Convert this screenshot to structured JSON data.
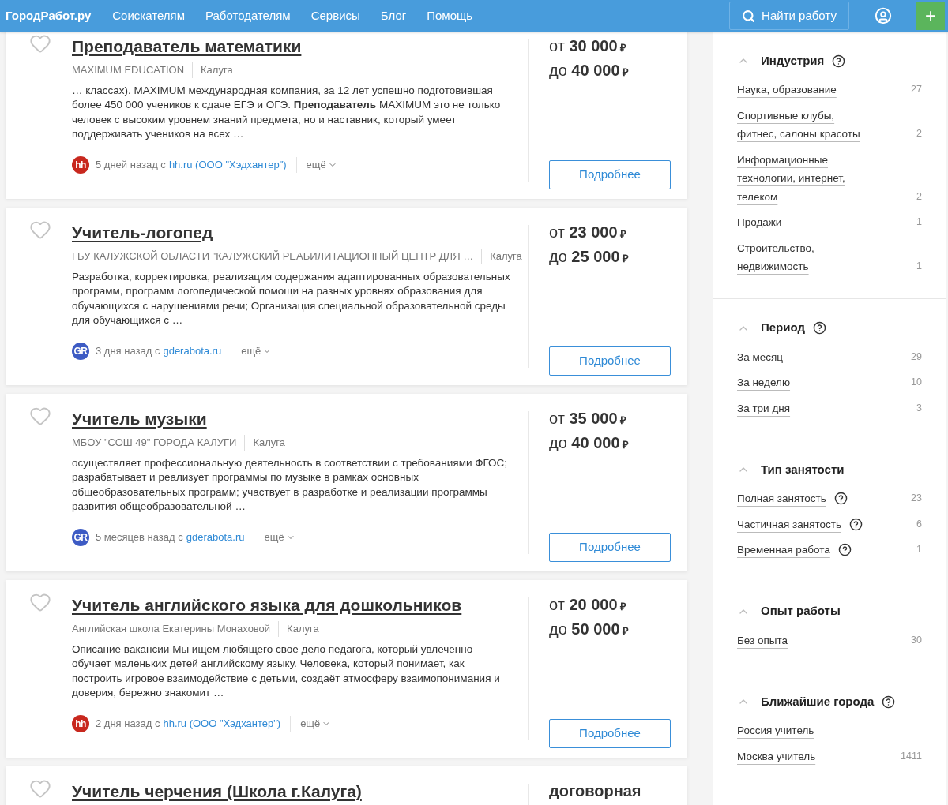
{
  "header": {
    "logo": "ГородРабот.ру",
    "nav": [
      "Соискателям",
      "Работодателям",
      "Сервисы",
      "Блог",
      "Помощь"
    ],
    "search_button": "Найти работу",
    "add_button": "+"
  },
  "vacancies": [
    {
      "title": "Преподаватель математики",
      "company": "MAXIMUM EDUCATION",
      "city": "Калуга",
      "description": "… классах). MAXIMUM международная компания, за 12 лет успешно подготовившая более 450 000 учеников к сдаче ЕГЭ и ОГЭ. **Преподаватель** MAXIMUM это не только человек с высоким уровнем знаний предмета, но и наставник, который умеет поддерживать учеников на всех …",
      "source_badge": "hh",
      "color": "#c8281e",
      "posted": "5 дней назад с",
      "source": "hh.ru (ООО \"Хэдхантер\")",
      "more": "ещё",
      "salary": [
        {
          "prefix": "от",
          "amount": "30 000",
          "currency": "₽"
        },
        {
          "prefix": "до",
          "amount": "40 000",
          "currency": "₽"
        }
      ],
      "details_button": "Подробнее"
    },
    {
      "title": "Учитель-логопед",
      "company": "ГБУ КАЛУЖСКОЙ ОБЛАСТИ \"КАЛУЖСКИЙ РЕАБИЛИТАЦИОННЫЙ ЦЕНТР ДЛЯ …",
      "city": "Калуга",
      "description": "Разработка, корректировка, реализация содержания адаптированных образовательных программ, программ логопедической помощи на разных уровнях образования для обучающихся с нарушениями речи; Организация специальной образовательной среды для обучающихся с …",
      "source_badge": "GR",
      "color": "#3d5bc4",
      "posted": "3 дня назад с",
      "source": "gderabota.ru",
      "more": "ещё",
      "salary": [
        {
          "prefix": "от",
          "amount": "23 000",
          "currency": "₽"
        },
        {
          "prefix": "до",
          "amount": "25 000",
          "currency": "₽"
        }
      ],
      "details_button": "Подробнее"
    },
    {
      "title": "Учитель музыки",
      "company": "МБОУ \"СОШ 49\" ГОРОДА КАЛУГИ",
      "city": "Калуга",
      "description": "осуществляет профессиональную деятельность в соответствии с требованиями ФГОС; разрабатывает и реализует программы по музыке в рамках основных общеобразовательных программ; участвует в разработке и реализации программы развития общеобразовательной …",
      "source_badge": "GR",
      "color": "#3d5bc4",
      "posted": "5 месяцев назад с",
      "source": "gderabota.ru",
      "more": "ещё",
      "salary": [
        {
          "prefix": "от",
          "amount": "35 000",
          "currency": "₽"
        },
        {
          "prefix": "до",
          "amount": "40 000",
          "currency": "₽"
        }
      ],
      "details_button": "Подробнее"
    },
    {
      "title": "Учитель английского языка для дошкольников",
      "company": "Английская школа Екатерины Монаховой",
      "city": "Калуга",
      "description": "Описание вакансии Мы ищем любящего свое дело педагога, который увлеченно обучает маленьких детей английскому языку. Человека, который понимает, как построить игровое взаимодействие с детьми, создаёт атмосферу взаимопонимания и доверия, бережно знакомит …",
      "source_badge": "hh",
      "color": "#c8281e",
      "posted": "2 дня назад с",
      "source": "hh.ru (ООО \"Хэдхантер\")",
      "more": "ещё",
      "salary": [
        {
          "prefix": "от",
          "amount": "20 000",
          "currency": "₽"
        },
        {
          "prefix": "до",
          "amount": "50 000",
          "currency": "₽"
        }
      ],
      "details_button": "Подробнее"
    },
    {
      "title": "Учитель черчения (Школа г.Калуга)",
      "salary": [
        {
          "amount": "договорная"
        }
      ]
    }
  ],
  "filters": [
    {
      "title": "Индустрия",
      "help": true,
      "expanded": true,
      "items": [
        {
          "label": "Наука, образование",
          "count": "27"
        },
        {
          "label": "Спортивные клубы, фитнес, салоны красоты",
          "count": "2"
        },
        {
          "label": "Информационные технологии, интернет, телеком",
          "count": "2"
        },
        {
          "label": "Продажи",
          "count": "1"
        },
        {
          "label": "Строительство, недвижимость",
          "count": "1"
        }
      ]
    },
    {
      "title": "Период",
      "help": true,
      "expanded": true,
      "items": [
        {
          "label": "За месяц",
          "count": "29"
        },
        {
          "label": "За неделю",
          "count": "10"
        },
        {
          "label": "За три дня",
          "count": "3"
        }
      ]
    },
    {
      "title": "Тип занятости",
      "help": false,
      "expanded": true,
      "items": [
        {
          "label": "Полная занятость",
          "help": true,
          "count": "23"
        },
        {
          "label": "Частичная занятость",
          "help": true,
          "count": "6"
        },
        {
          "label": "Временная работа",
          "help": true,
          "count": "1"
        }
      ]
    },
    {
      "title": "Опыт работы",
      "help": false,
      "expanded": true,
      "items": [
        {
          "label": "Без опыта",
          "count": "30"
        }
      ]
    },
    {
      "title": "Ближайшие города",
      "help": true,
      "expanded": true,
      "items": [
        {
          "label": "Россия учитель"
        },
        {
          "label": "Москва учитель",
          "count": "1411"
        }
      ]
    }
  ]
}
